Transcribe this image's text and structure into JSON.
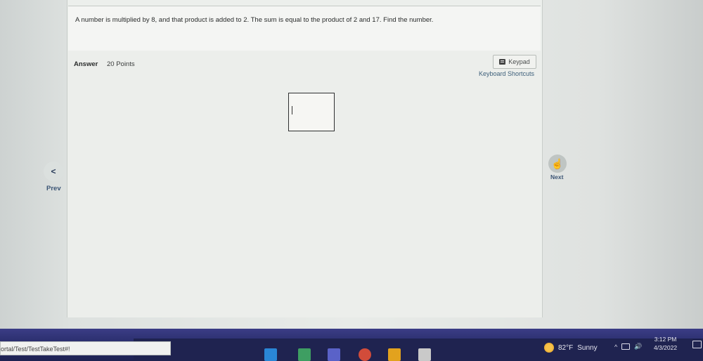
{
  "question": {
    "text": "A number is multiplied by 8, and that product is added to 2. The sum is equal to the product of 2 and 17. Find the number."
  },
  "answer": {
    "label": "Answer",
    "points": "20 Points",
    "value": "",
    "keypad_label": "Keypad",
    "keyboard_shortcuts_label": "Keyboard Shortcuts"
  },
  "navigation": {
    "prev_glyph": "<",
    "prev_label": "Prev",
    "next_glyph": "☝",
    "next_label": "Next"
  },
  "status_bar": {
    "url": "ortal/Test/TestTakeTest#!"
  },
  "taskbar": {
    "weather_temp": "82°F",
    "weather_desc": "Sunny",
    "tray_chevron": "^",
    "tray_sound": "🔊",
    "time": "3:12 PM",
    "date": "4/3/2022",
    "icons": [
      "file-explorer-icon",
      "mail-icon",
      "teams-icon",
      "chrome-icon",
      "app-icon",
      "document-icon"
    ]
  },
  "colors": {
    "link": "#3d5f7a",
    "taskbar": "#2b2f6e",
    "nav_label": "#3b5575"
  }
}
